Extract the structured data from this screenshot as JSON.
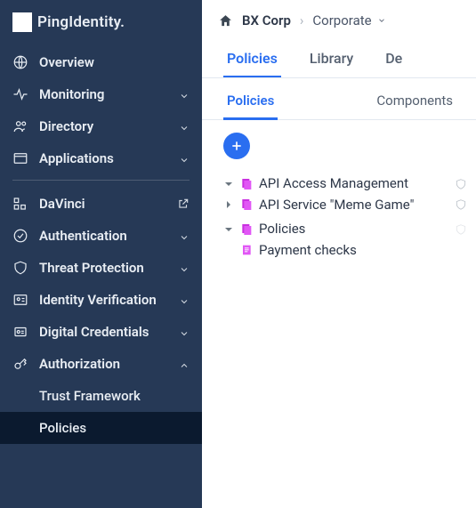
{
  "brand": {
    "name": "PingIdentity."
  },
  "sidebar": {
    "groups": {
      "main": [
        {
          "label": "Overview",
          "icon": "globe",
          "expandable": false
        },
        {
          "label": "Monitoring",
          "icon": "activity",
          "expandable": true
        },
        {
          "label": "Directory",
          "icon": "people",
          "expandable": true
        },
        {
          "label": "Applications",
          "icon": "window",
          "expandable": true
        }
      ],
      "secondary": [
        {
          "label": "DaVinci",
          "icon": "puzzle",
          "external": true
        },
        {
          "label": "Authentication",
          "icon": "check-circle",
          "expandable": true
        },
        {
          "label": "Threat Protection",
          "icon": "shield",
          "expandable": true
        },
        {
          "label": "Identity Verification",
          "icon": "id-card",
          "expandable": true
        },
        {
          "label": "Digital Credentials",
          "icon": "cred",
          "expandable": true
        },
        {
          "label": "Authorization",
          "icon": "key",
          "expandable": true,
          "expanded": true,
          "children": [
            {
              "label": "Trust Framework",
              "active": false
            },
            {
              "label": "Policies",
              "active": true
            }
          ]
        }
      ]
    }
  },
  "breadcrumb": {
    "org": "BX Corp",
    "env": "Corporate"
  },
  "tabs_lv1": [
    {
      "label": "Policies",
      "active": true
    },
    {
      "label": "Library"
    },
    {
      "label": "De"
    }
  ],
  "tabs_lv2": [
    {
      "label": "Policies",
      "active": true
    },
    {
      "label": "Components"
    }
  ],
  "tree": {
    "root": {
      "label": "API Access Management",
      "expanded": true,
      "shield": true,
      "children": [
        {
          "label": "API Service \"Meme Game\"",
          "expandable": true,
          "expanded": false,
          "shield": true
        },
        {
          "label": "Policies",
          "expandable": true,
          "expanded": true,
          "shield_light": true,
          "children": [
            {
              "label": "Payment checks"
            }
          ]
        }
      ]
    }
  }
}
